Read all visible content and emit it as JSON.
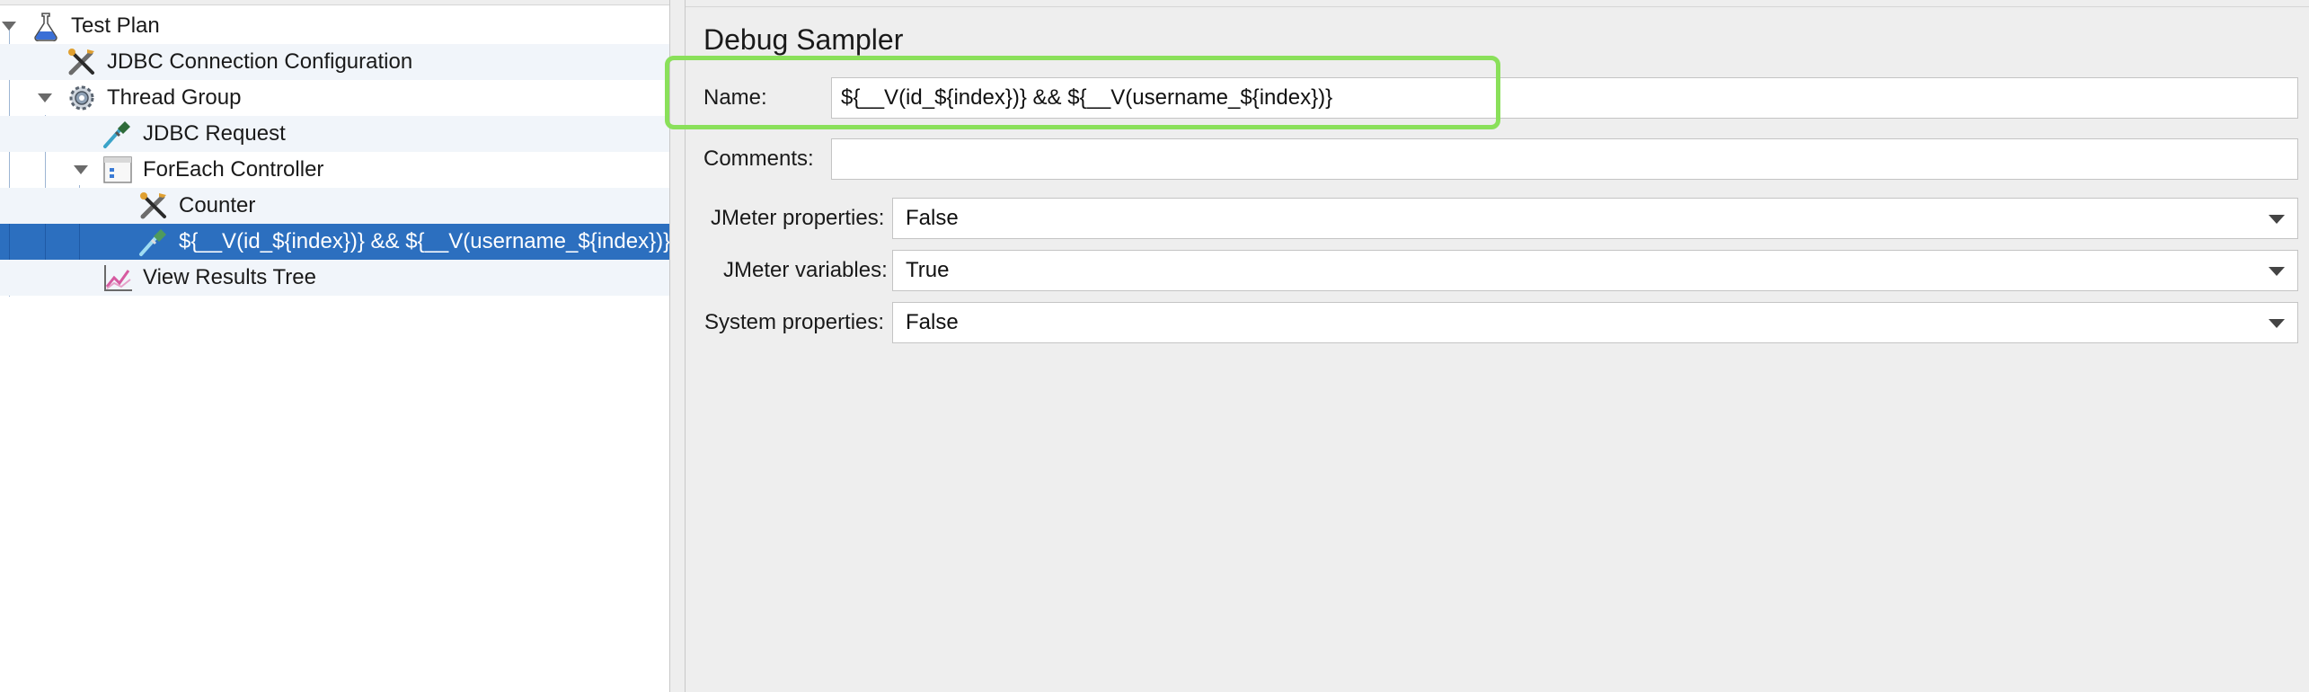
{
  "tree": {
    "items": [
      {
        "label": "Test Plan",
        "icon": "test-plan-flask-icon"
      },
      {
        "label": "JDBC Connection Configuration",
        "icon": "config-tools-icon"
      },
      {
        "label": "Thread Group",
        "icon": "thread-group-gear-icon"
      },
      {
        "label": "JDBC Request",
        "icon": "sampler-pipette-icon"
      },
      {
        "label": "ForEach Controller",
        "icon": "controller-icon"
      },
      {
        "label": "Counter",
        "icon": "config-tools-icon"
      },
      {
        "label": "${__V(id_${index})} && ${__V(username_${index})}",
        "icon": "sampler-pipette-icon"
      },
      {
        "label": "View Results Tree",
        "icon": "listener-graph-icon"
      }
    ]
  },
  "panel": {
    "title": "Debug Sampler",
    "name_label": "Name:",
    "name_value": "${__V(id_${index})} && ${__V(username_${index})}",
    "comments_label": "Comments:",
    "comments_value": "",
    "jmeter_properties_label": "JMeter properties:",
    "jmeter_properties_value": "False",
    "jmeter_variables_label": "JMeter variables:",
    "jmeter_variables_value": "True",
    "system_properties_label": "System properties:",
    "system_properties_value": "False"
  },
  "colors": {
    "selection": "#2c6fbf",
    "highlight_border": "#8ae05a",
    "panel_background": "#eeeeee"
  }
}
